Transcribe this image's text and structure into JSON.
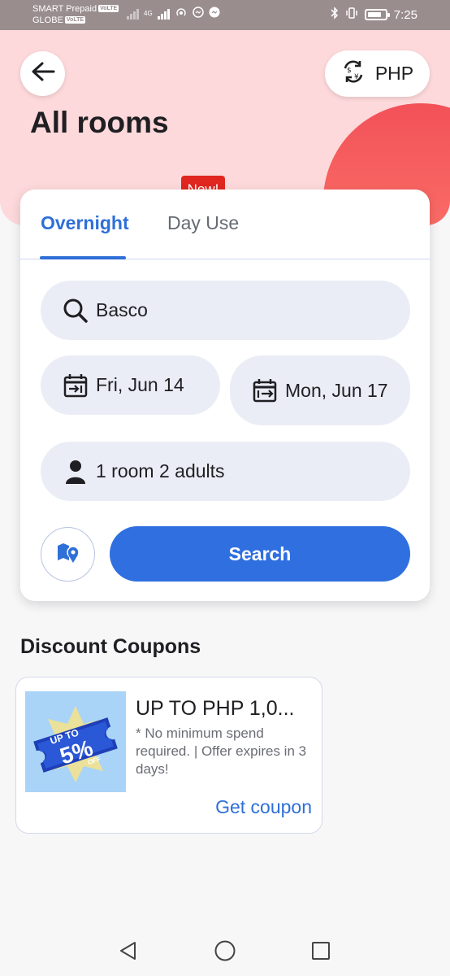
{
  "status_bar": {
    "carrier_1": "SMART Prepaid",
    "carrier_2": "GLOBE",
    "volte_badge": "VoLTE",
    "network_type": "4G",
    "time": "7:25",
    "battery_level": 0.8
  },
  "header": {
    "title": "All rooms",
    "currency_label": "PHP",
    "back_icon": "arrow-left-icon",
    "currency_icon": "currency-exchange-icon"
  },
  "tabs": [
    {
      "label": "Overnight",
      "active": true
    },
    {
      "label": "Day Use",
      "active": false,
      "badge": "New!"
    }
  ],
  "search": {
    "destination": "Basco",
    "check_in": "Fri, Jun 14",
    "check_out": "Mon, Jun 17",
    "guests": "1 room 2 adults",
    "button_label": "Search"
  },
  "coupons": {
    "section_title": "Discount Coupons",
    "items": [
      {
        "title": "UP TO PHP 1,0...",
        "description": "* No minimum spend required.  | Offer expires in 3 days!",
        "link": "Get coupon",
        "image_text_top": "UP TO",
        "image_text_value": "5%",
        "image_text_bottom": "OFF"
      }
    ]
  },
  "colors": {
    "accent": "#2f6fe0",
    "hero_bg": "#fdd9db",
    "badge_red": "#e0261f"
  }
}
